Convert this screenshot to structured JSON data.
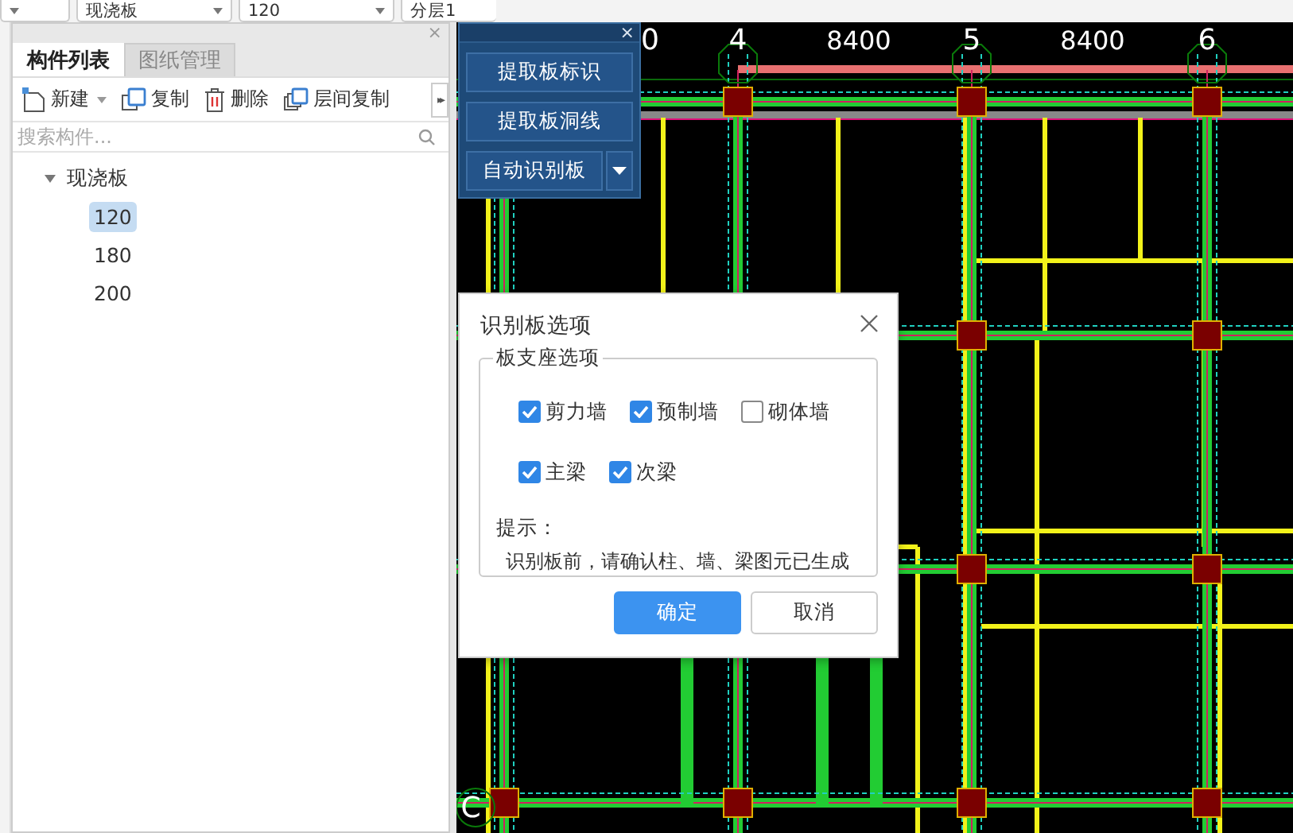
{
  "top_bar": {
    "dropdowns": [
      {
        "kind": "dropdown"
      },
      {
        "kind": "dropdown",
        "value": "现浇板"
      },
      {
        "kind": "dropdown",
        "value": "120"
      },
      {
        "kind": "dropdown",
        "value": "分层1"
      }
    ]
  },
  "component_panel": {
    "close": "×",
    "tabs": [
      {
        "label": "构件列表",
        "selected": true
      },
      {
        "label": "图纸管理",
        "selected": false
      }
    ],
    "toolbar": [
      {
        "kind": "new",
        "label": "新建",
        "has_menu": true
      },
      {
        "kind": "copy",
        "label": "复制",
        "has_menu": false
      },
      {
        "kind": "delete",
        "label": "删除",
        "has_menu": false
      },
      {
        "kind": "floor-copy",
        "label": "层间复制",
        "has_menu": false
      }
    ],
    "more": "▸▸",
    "search": {
      "placeholder": "搜索构件..."
    },
    "tree": [
      {
        "label": "现浇板",
        "expanded": true,
        "selected": false,
        "children": [
          {
            "label": "120",
            "selected": true
          },
          {
            "label": "180",
            "selected": false
          },
          {
            "label": "200",
            "selected": false
          }
        ]
      }
    ]
  },
  "cad": {
    "axis_labels": [
      {
        "text": "0",
        "kind": "number"
      },
      {
        "text": "4",
        "kind": "bubble"
      },
      {
        "text": "8400",
        "kind": "dimension"
      },
      {
        "text": "5",
        "kind": "bubble"
      },
      {
        "text": "8400",
        "kind": "dimension"
      },
      {
        "text": "6",
        "kind": "bubble"
      },
      {
        "text": "C",
        "kind": "bubble"
      }
    ]
  },
  "toolbox": {
    "close": "×",
    "buttons": [
      {
        "label": "提取板标识",
        "has_menu": false
      },
      {
        "label": "提取板洞线",
        "has_menu": false
      },
      {
        "label": "自动识别板",
        "has_menu": true
      }
    ]
  },
  "dialog": {
    "title": "识别板选项",
    "group_title": "板支座选项",
    "options": [
      [
        {
          "label": "剪力墙",
          "checked": true
        },
        {
          "label": "预制墙",
          "checked": true
        },
        {
          "label": "砌体墙",
          "checked": false
        }
      ],
      [
        {
          "label": "主梁",
          "checked": true
        },
        {
          "label": "次梁",
          "checked": true
        }
      ]
    ],
    "hint_title": "提示：",
    "hint": "识别板前，请确认柱、墙、梁图元已生成",
    "buttons": [
      {
        "label": "确定",
        "primary": true
      },
      {
        "label": "取消",
        "primary": false
      }
    ]
  }
}
